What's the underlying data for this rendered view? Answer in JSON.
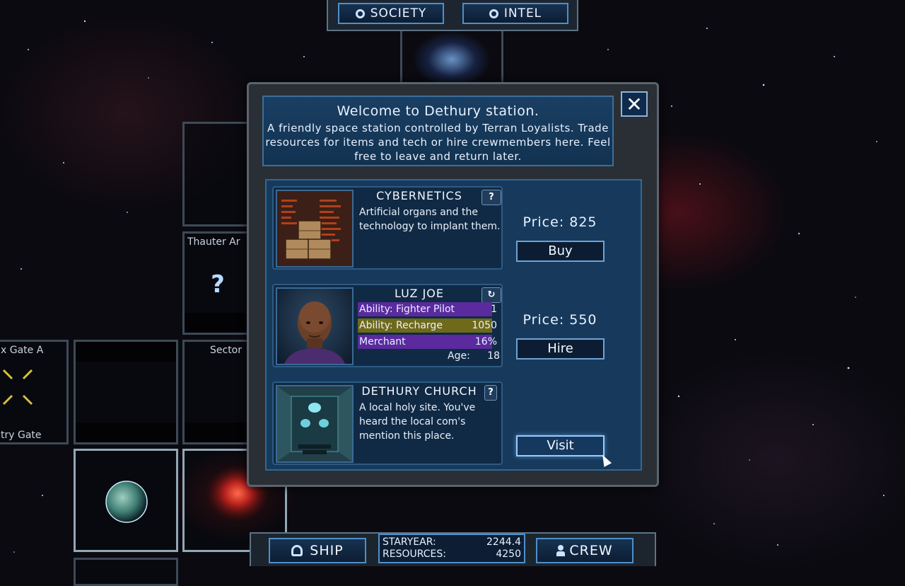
{
  "top_nav": {
    "society_label": "SOCIETY",
    "intel_label": "INTEL"
  },
  "map": {
    "tiles": [
      {
        "name": "Thauter Ar",
        "unknown_marker": "?"
      },
      {
        "name": "x Gate A",
        "sub": "try Gate"
      },
      {
        "name": "Sector"
      }
    ]
  },
  "dialog": {
    "title": "Welcome to Dethury station.",
    "description": "A friendly space station controlled by Terran Loyalists. Trade resources for items and tech or hire crewmembers here. Feel free to leave and return later.",
    "close_label": "✕",
    "items": [
      {
        "name": "CYBERNETICS",
        "description": "Artificial organs and the technology to implant them.",
        "help_label": "?",
        "price_text": "Price: 825",
        "action_label": "Buy"
      },
      {
        "name": "LUZ JOE",
        "refresh_label": "↻",
        "abilities": [
          {
            "label": "Ability: Fighter Pilot",
            "value": "1",
            "color": "#5a2a9e",
            "fill": 0.95
          },
          {
            "label": "Ability:  Recharge",
            "value": "1050",
            "color": "#6e6a1a",
            "fill": 0.95
          },
          {
            "label": "Merchant",
            "value": "16%",
            "color": "#5a2a9e",
            "fill": 0.95
          }
        ],
        "age_label": "Age:",
        "age_value": "18",
        "price_text": "Price: 550",
        "action_label": "Hire"
      },
      {
        "name": "DETHURY CHURCH",
        "description": "A local holy site. You've heard the local com's mention this place.",
        "help_label": "?",
        "action_label": "Visit"
      }
    ]
  },
  "bottom_bar": {
    "ship_label": "SHIP",
    "crew_label": "CREW",
    "staryear_label": "STARYEAR:",
    "staryear_value": "2244.4",
    "resources_label": "RESOURCES:",
    "resources_value": "4250"
  },
  "colors": {
    "accent": "#4e8fc9",
    "panel": "#173a5c",
    "frame": "#2a2f35"
  }
}
